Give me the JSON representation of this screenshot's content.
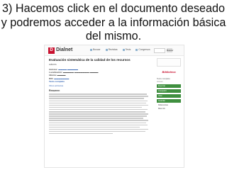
{
  "slide": {
    "title_lines": [
      "3) Hacemos click en el documento deseado",
      "y podremos acceder a la información básica",
      "del mismo."
    ]
  },
  "screenshot": {
    "logo_mark": "D",
    "logo_text": "Dialnet",
    "nav": [
      "Buscar",
      "Revistas",
      "Tesis",
      "Congresos",
      "Ayuda"
    ],
    "search_button": "Buscar",
    "document": {
      "title": "Evaluación sistemática de la calidad de los recursos",
      "authors": "autores",
      "meta": [
        {
          "k": "Autores:",
          "v": "",
          "link": true
        },
        {
          "k": "Localización:",
          "v": "",
          "link": false
        },
        {
          "k": "Idioma:",
          "v": "",
          "link": false
        },
        {
          "k": "DOI:",
          "v": "",
          "link": true
        },
        {
          "k": "Texto completo",
          "v": "",
          "link": true
        }
      ],
      "section_link": "Otros artículos",
      "abstract_head": "Resumen"
    },
    "sidebar": {
      "badge": "Biblioteca",
      "label_1": "Texto completo",
      "label_2": "Acceso",
      "buttons": [
        "Exportar",
        "Compartir",
        "Citar",
        "Guardar"
      ],
      "plain_items": [
        "Referencias",
        "Más info"
      ]
    }
  },
  "colors": {
    "brand_red": "#c8102e",
    "link_blue": "#2a5db0",
    "button_green": "#3f8f3f"
  }
}
